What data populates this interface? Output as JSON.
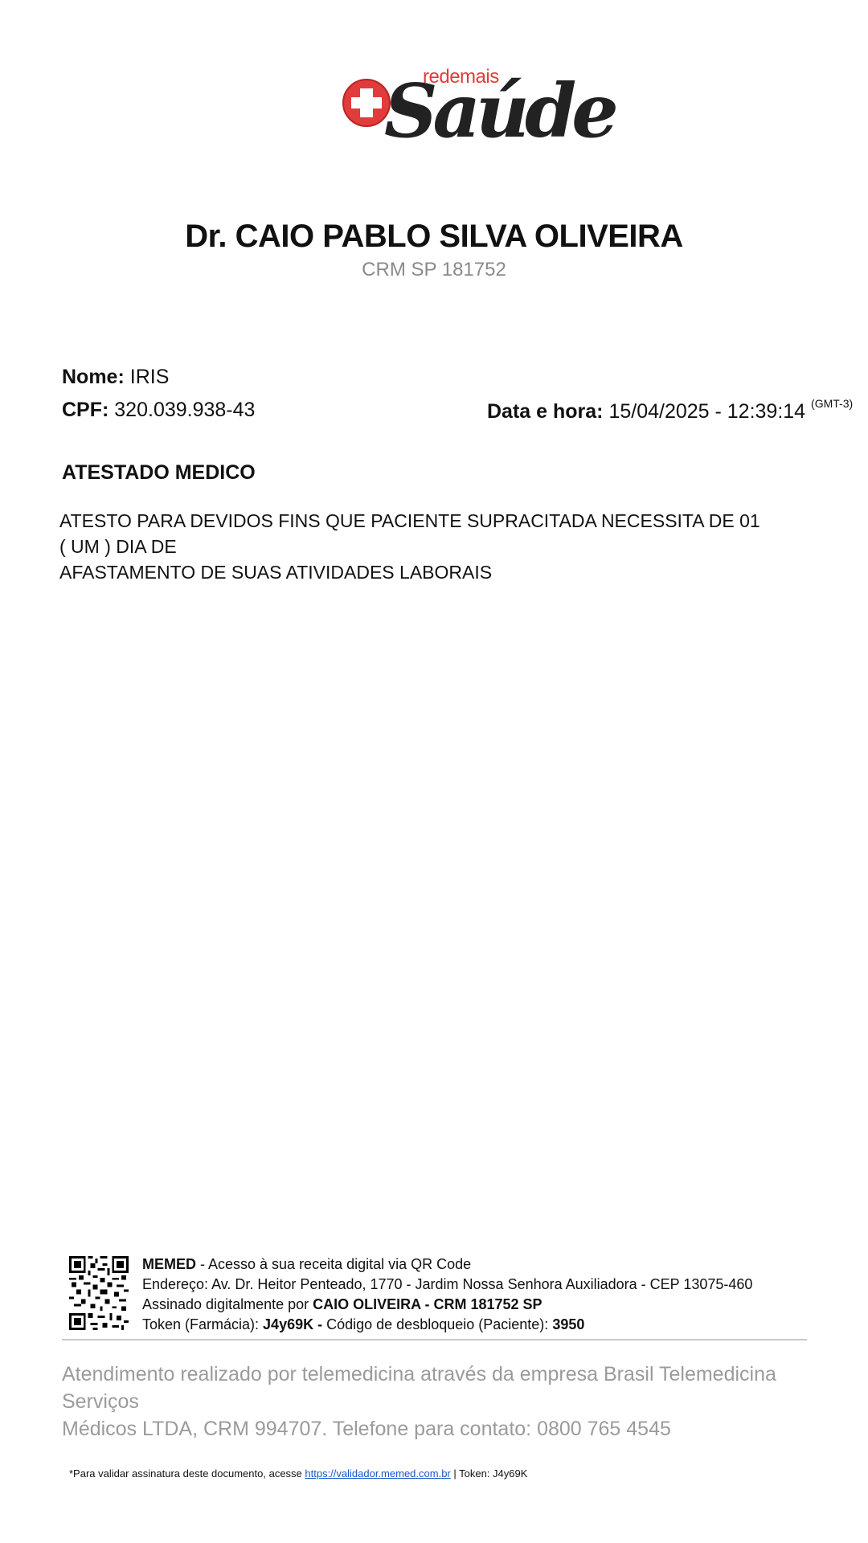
{
  "logo": {
    "small_text": "redemais",
    "brand_text": "Saúde"
  },
  "doctor": {
    "name": "Dr. CAIO PABLO SILVA OLIVEIRA",
    "crm": "CRM SP 181752"
  },
  "patient": {
    "name_label": "Nome:",
    "name_value": "IRIS",
    "cpf_label": "CPF:",
    "cpf_value": "320.039.938-43",
    "datetime_label": "Data e hora:",
    "datetime_value": "15/04/2025 - 12:39:14",
    "timezone": "(GMT-3)"
  },
  "document": {
    "title": "ATESTADO MEDICO",
    "line1": "ATESTO PARA DEVIDOS FINS QUE PACIENTE SUPRACITADA NECESSITA DE 01 ( UM ) DIA DE",
    "line2": "AFASTAMENTO DE SUAS ATIVIDADES LABORAIS"
  },
  "footer": {
    "memed_bold": "MEMED",
    "memed_text": " - Acesso à sua receita digital via QR Code",
    "address": "Endereço: Av. Dr. Heitor Penteado, 1770 - Jardim Nossa Senhora Auxiliadora - CEP 13075-460",
    "signed_prefix": "Assinado digitalmente por ",
    "signed_bold": "CAIO OLIVEIRA - CRM 181752 SP",
    "token_prefix": "Token (Farmácia): ",
    "token_bold": "J4y69K -",
    "unlock_text": " Código de desbloqueio (Paciente): ",
    "unlock_bold": "3950",
    "telemedicine_line1": "Atendimento realizado por telemedicina através da empresa Brasil Telemedicina Serviços",
    "telemedicine_line2": "Médicos LTDA, CRM 994707. Telefone para contato: 0800 765 4545",
    "validate_prefix": "*Para validar assinatura deste documento, acesse ",
    "validate_link": "https://validador.memed.com.br",
    "validate_suffix": " | Token: J4y69K"
  },
  "colors": {
    "logo_red": "#e23b3b",
    "logo_dark": "#222222",
    "muted": "#9b9b9b",
    "link": "#1a56c8"
  }
}
